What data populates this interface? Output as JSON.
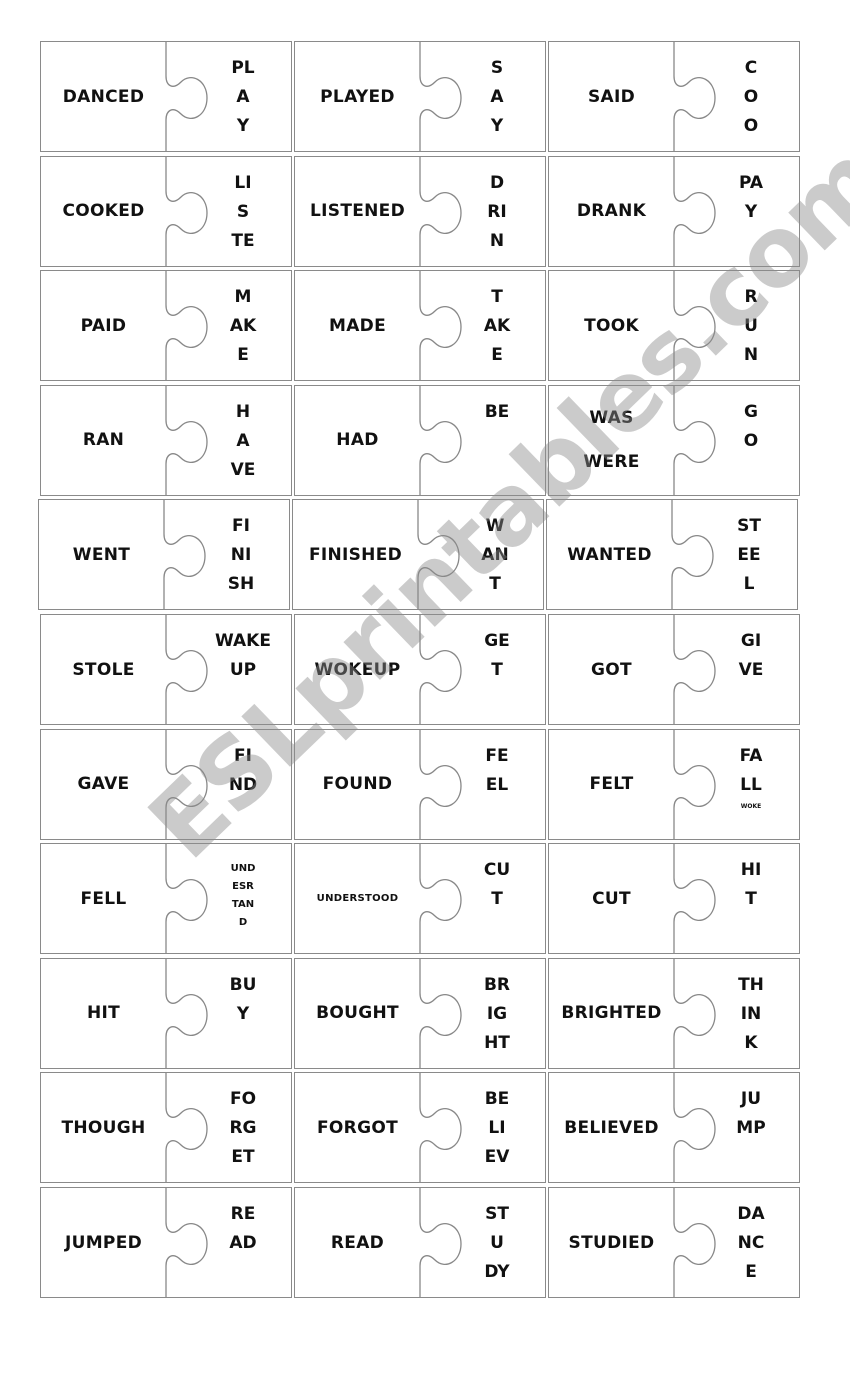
{
  "watermark": "ESLprintables.com",
  "rows": [
    [
      {
        "left": [
          "DANCED"
        ],
        "right": [
          "PL",
          "A",
          "Y"
        ]
      },
      {
        "left": [
          "PLAYED"
        ],
        "right": [
          "S",
          "A",
          "Y"
        ]
      },
      {
        "left": [
          "SAID"
        ],
        "right": [
          "C",
          "O",
          "O"
        ]
      }
    ],
    [
      {
        "left": [
          "COOKED"
        ],
        "right": [
          "LI",
          "S",
          "TE"
        ]
      },
      {
        "left": [
          "LISTENED"
        ],
        "right": [
          "D",
          "RI",
          "N"
        ]
      },
      {
        "left": [
          "DRANK"
        ],
        "right": [
          "PA",
          "Y"
        ]
      }
    ],
    [
      {
        "left": [
          "PAID"
        ],
        "right": [
          "M",
          "AK",
          "E"
        ]
      },
      {
        "left": [
          "MADE"
        ],
        "right": [
          "T",
          "AK",
          "E"
        ]
      },
      {
        "left": [
          "TOOK"
        ],
        "right": [
          "R",
          "U",
          "N"
        ]
      }
    ],
    [
      {
        "left": [
          "RAN"
        ],
        "right": [
          "H",
          "A",
          "VE"
        ]
      },
      {
        "left": [
          "HAD"
        ],
        "right": [
          "BE"
        ]
      },
      {
        "left": [
          "WAS",
          "WERE"
        ],
        "right": [
          "G",
          "O"
        ]
      }
    ],
    [
      {
        "left": [
          "WENT"
        ],
        "right": [
          "FI",
          "NI",
          "SH"
        ]
      },
      {
        "left": [
          "FINISHED"
        ],
        "right": [
          "W",
          "AN",
          "T"
        ]
      },
      {
        "left": [
          "WANTED"
        ],
        "right": [
          "ST",
          "EE",
          "L"
        ]
      }
    ],
    [
      {
        "left": [
          "STOLE"
        ],
        "right": [
          "WAKE",
          "UP"
        ]
      },
      {
        "left": [
          "WOKEUP"
        ],
        "right": [
          "GE",
          "T"
        ]
      },
      {
        "left": [
          "GOT"
        ],
        "right": [
          "GI",
          "VE"
        ]
      }
    ],
    [
      {
        "left": [
          "GAVE"
        ],
        "right": [
          "FI",
          "ND"
        ]
      },
      {
        "left": [
          "FOUND"
        ],
        "right": [
          "FE",
          "EL"
        ]
      },
      {
        "left": [
          "FELT"
        ],
        "right": [
          "FA",
          "LL"
        ],
        "tiny": "WOKE"
      }
    ],
    [
      {
        "left": [
          "FELL"
        ],
        "right": [
          "UND",
          "ESR",
          "TAN",
          "D"
        ],
        "right_small": true
      },
      {
        "left": [
          "UNDERSTOOD"
        ],
        "left_small": true,
        "right": [
          "CU",
          "T"
        ]
      },
      {
        "left": [
          "CUT"
        ],
        "right": [
          "HI",
          "T"
        ]
      }
    ],
    [
      {
        "left": [
          "HIT"
        ],
        "right": [
          "BU",
          "Y"
        ]
      },
      {
        "left": [
          "BOUGHT"
        ],
        "right": [
          "BR",
          "IG",
          "HT"
        ]
      },
      {
        "left": [
          "BRIGHTED"
        ],
        "right": [
          "TH",
          "IN",
          "K"
        ]
      }
    ],
    [
      {
        "left": [
          "THOUGH"
        ],
        "right": [
          "FO",
          "RG",
          "ET"
        ]
      },
      {
        "left": [
          "FORGOT"
        ],
        "right": [
          "BE",
          "LI",
          "EV"
        ]
      },
      {
        "left": [
          "BELIEVED"
        ],
        "right": [
          "JU",
          "MP"
        ]
      }
    ],
    [
      {
        "left": [
          "JUMPED"
        ],
        "right": [
          "RE",
          "AD"
        ]
      },
      {
        "left": [
          "READ"
        ],
        "right": [
          "ST",
          "U",
          "DY"
        ]
      },
      {
        "left": [
          "STUDIED"
        ],
        "right": [
          "DA",
          "NC",
          "E"
        ]
      }
    ]
  ]
}
